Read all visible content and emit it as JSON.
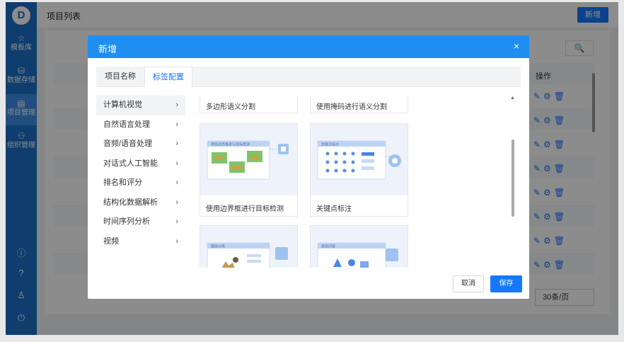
{
  "sidebar": {
    "logo": "D",
    "items": [
      {
        "icon": "star-icon",
        "glyph": "☆",
        "label": "模板库"
      },
      {
        "icon": "database-icon",
        "glyph": "⛁",
        "label": "数据存储"
      },
      {
        "icon": "project-icon",
        "glyph": "▤",
        "label": "项目管理"
      },
      {
        "icon": "org-icon",
        "glyph": "⚇",
        "label": "组织管理"
      }
    ],
    "bottom_icons": [
      {
        "icon": "info-icon",
        "glyph": "ⓘ"
      },
      {
        "icon": "help-icon",
        "glyph": "?"
      },
      {
        "icon": "user-icon",
        "glyph": "♙"
      },
      {
        "icon": "power-icon",
        "glyph": "⏻"
      }
    ]
  },
  "header": {
    "title": "项目列表",
    "add_label": "新增"
  },
  "table": {
    "op_header": "操作",
    "search_glyph": "🔍",
    "page_size": "30条/页"
  },
  "modal": {
    "title": "新增",
    "close_glyph": "×",
    "tabs": [
      {
        "label": "项目名称",
        "active": false
      },
      {
        "label": "标签配置",
        "active": true
      }
    ],
    "categories": [
      {
        "label": "计算机视觉",
        "active": true
      },
      {
        "label": "自然语言处理",
        "active": false
      },
      {
        "label": "音频/语音处理",
        "active": false
      },
      {
        "label": "对话式人工智能",
        "active": false
      },
      {
        "label": "排名和评分",
        "active": false
      },
      {
        "label": "结构化数据解析",
        "active": false
      },
      {
        "label": "时间序列分析",
        "active": false
      },
      {
        "label": "视频",
        "active": false
      }
    ],
    "chevron": "›",
    "cards": [
      {
        "label": "多边形语义分割"
      },
      {
        "label": "使用掩码进行语义分割"
      },
      {
        "label": "使用边界框进行目标检测",
        "thumb_caption": "使用边界框进行目标检测"
      },
      {
        "label": "关键点标注",
        "thumb_caption": "关键点标注"
      },
      {
        "label": "",
        "thumb_caption": "图像分类"
      },
      {
        "label": "",
        "thumb_caption": "视觉问答"
      }
    ],
    "cancel_label": "取消",
    "save_label": "保存"
  }
}
